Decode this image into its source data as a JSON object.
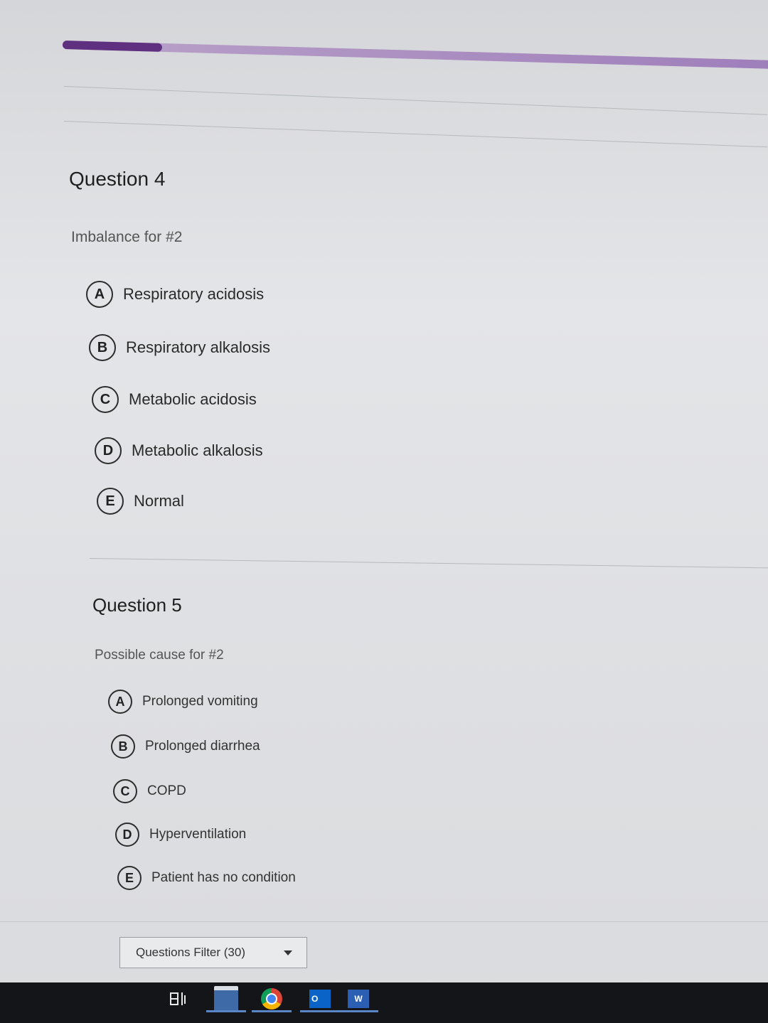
{
  "progress": {
    "fraction": 0.14,
    "colors": {
      "fill": "#5f2f80",
      "track": "#a98cc0"
    }
  },
  "questions": [
    {
      "title": "Question 4",
      "prompt": "Imbalance for #2",
      "options": [
        {
          "letter": "A",
          "text": "Respiratory acidosis"
        },
        {
          "letter": "B",
          "text": "Respiratory alkalosis"
        },
        {
          "letter": "C",
          "text": "Metabolic acidosis"
        },
        {
          "letter": "D",
          "text": "Metabolic alkalosis"
        },
        {
          "letter": "E",
          "text": "Normal"
        }
      ]
    },
    {
      "title": "Question 5",
      "prompt": "Possible cause for #2",
      "options": [
        {
          "letter": "A",
          "text": "Prolonged vomiting"
        },
        {
          "letter": "B",
          "text": "Prolonged diarrhea"
        },
        {
          "letter": "C",
          "text": "COPD"
        },
        {
          "letter": "D",
          "text": "Hyperventilation"
        },
        {
          "letter": "E",
          "text": "Patient has no condition"
        }
      ]
    }
  ],
  "filter": {
    "label": "Questions Filter (30)"
  },
  "taskbar": {
    "items": [
      {
        "icon": "task-view-icon"
      },
      {
        "icon": "file-explorer-icon"
      },
      {
        "icon": "chrome-icon"
      },
      {
        "icon": "outlook-icon",
        "letter": "O"
      },
      {
        "icon": "word-icon",
        "letter": "W"
      }
    ]
  }
}
